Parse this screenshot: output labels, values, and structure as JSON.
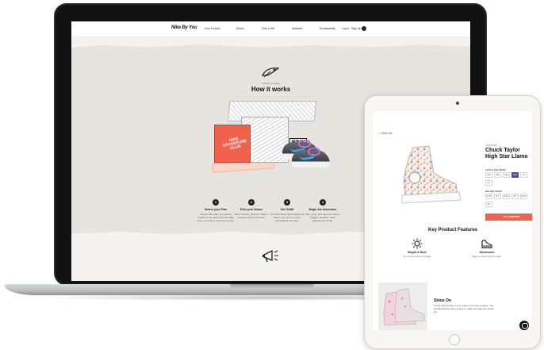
{
  "site": {
    "logo": "Nike By You",
    "nav": [
      "How it Works",
      "Shoes",
      "Give a Gift",
      "Activities",
      "Sustainability"
    ],
    "account": "Log in · Sign Up"
  },
  "hero": {
    "eyebrow": "adventure awaits",
    "title": "How it works",
    "box_front_text": "NIKE ADVENTURE CLUB",
    "box_name": "FINN"
  },
  "steps": [
    {
      "num": "1",
      "title": "Select your Plan",
      "desc": "Choose how often you want to receive a new adventure-rich Nike shoe, a month or four times a year."
    },
    {
      "num": "2",
      "title": "Pick your Shoes",
      "desc": "When it's time, pick your Nike or Converse shoes of choice."
    },
    {
      "num": "3",
      "title": "Get Outfit",
      "desc": "Your kid's shoes (and activity kit) ship to your door in a box personalized for them."
    },
    {
      "num": "4",
      "title": "Begin the Adventure",
      "desc": "Run, jump, and play your way to happier, healthier, more adventurous family."
    }
  ],
  "product": {
    "back": "< View All",
    "brand": "Converse",
    "name": "Chuck Taylor High Star Llama",
    "size_label_1": "LITTLE KID SIZES",
    "sizes_1": [
      "10c",
      "11c",
      "12c",
      "13c",
      "1Y",
      "2Y"
    ],
    "active_size": "13c",
    "size_label_2": "BIG KID SIZES",
    "sizes_2": [
      "3.5Y",
      "4Y",
      "4.5Y",
      "5Y",
      "5.5Y",
      "6Y"
    ],
    "cta": "GET STARTED"
  },
  "features": {
    "title": "Key Product Features",
    "items": [
      {
        "title": "Bright & Bold",
        "desc": "Fun colors that turn heads"
      },
      {
        "title": "Shoehorns",
        "desc": "Easy on and comfy to wear"
      }
    ]
  },
  "shine": {
    "title": "Shine On",
    "desc": "A bold and fun take on the iconic Converse sneaker. The printed canvas upper is sure to make any little one stand out."
  },
  "colors": {
    "accent": "#f0614e",
    "size_active": "#4b4fa8"
  }
}
